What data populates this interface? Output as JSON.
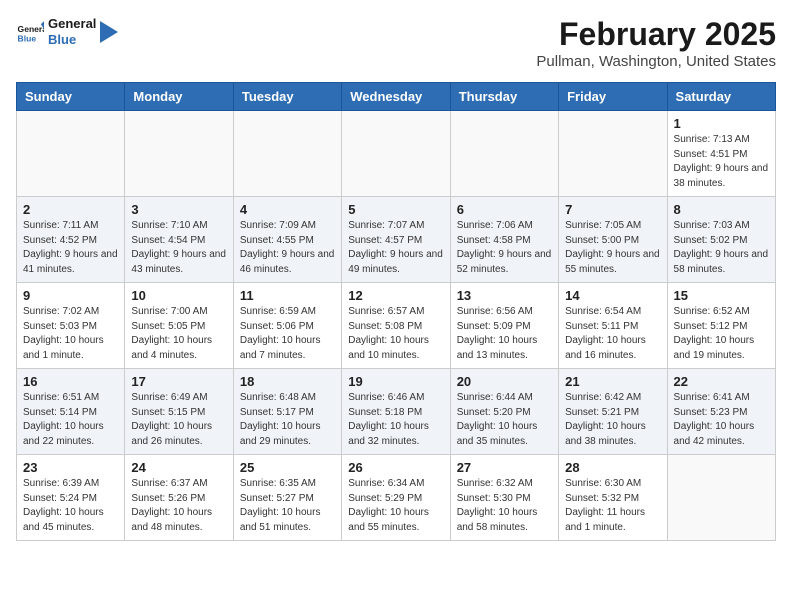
{
  "app": {
    "name_part1": "General",
    "name_part2": "Blue"
  },
  "header": {
    "month": "February 2025",
    "location": "Pullman, Washington, United States"
  },
  "weekdays": [
    "Sunday",
    "Monday",
    "Tuesday",
    "Wednesday",
    "Thursday",
    "Friday",
    "Saturday"
  ],
  "weeks": [
    [
      {
        "num": "",
        "info": ""
      },
      {
        "num": "",
        "info": ""
      },
      {
        "num": "",
        "info": ""
      },
      {
        "num": "",
        "info": ""
      },
      {
        "num": "",
        "info": ""
      },
      {
        "num": "",
        "info": ""
      },
      {
        "num": "1",
        "info": "Sunrise: 7:13 AM\nSunset: 4:51 PM\nDaylight: 9 hours and 38 minutes."
      }
    ],
    [
      {
        "num": "2",
        "info": "Sunrise: 7:11 AM\nSunset: 4:52 PM\nDaylight: 9 hours and 41 minutes."
      },
      {
        "num": "3",
        "info": "Sunrise: 7:10 AM\nSunset: 4:54 PM\nDaylight: 9 hours and 43 minutes."
      },
      {
        "num": "4",
        "info": "Sunrise: 7:09 AM\nSunset: 4:55 PM\nDaylight: 9 hours and 46 minutes."
      },
      {
        "num": "5",
        "info": "Sunrise: 7:07 AM\nSunset: 4:57 PM\nDaylight: 9 hours and 49 minutes."
      },
      {
        "num": "6",
        "info": "Sunrise: 7:06 AM\nSunset: 4:58 PM\nDaylight: 9 hours and 52 minutes."
      },
      {
        "num": "7",
        "info": "Sunrise: 7:05 AM\nSunset: 5:00 PM\nDaylight: 9 hours and 55 minutes."
      },
      {
        "num": "8",
        "info": "Sunrise: 7:03 AM\nSunset: 5:02 PM\nDaylight: 9 hours and 58 minutes."
      }
    ],
    [
      {
        "num": "9",
        "info": "Sunrise: 7:02 AM\nSunset: 5:03 PM\nDaylight: 10 hours and 1 minute."
      },
      {
        "num": "10",
        "info": "Sunrise: 7:00 AM\nSunset: 5:05 PM\nDaylight: 10 hours and 4 minutes."
      },
      {
        "num": "11",
        "info": "Sunrise: 6:59 AM\nSunset: 5:06 PM\nDaylight: 10 hours and 7 minutes."
      },
      {
        "num": "12",
        "info": "Sunrise: 6:57 AM\nSunset: 5:08 PM\nDaylight: 10 hours and 10 minutes."
      },
      {
        "num": "13",
        "info": "Sunrise: 6:56 AM\nSunset: 5:09 PM\nDaylight: 10 hours and 13 minutes."
      },
      {
        "num": "14",
        "info": "Sunrise: 6:54 AM\nSunset: 5:11 PM\nDaylight: 10 hours and 16 minutes."
      },
      {
        "num": "15",
        "info": "Sunrise: 6:52 AM\nSunset: 5:12 PM\nDaylight: 10 hours and 19 minutes."
      }
    ],
    [
      {
        "num": "16",
        "info": "Sunrise: 6:51 AM\nSunset: 5:14 PM\nDaylight: 10 hours and 22 minutes."
      },
      {
        "num": "17",
        "info": "Sunrise: 6:49 AM\nSunset: 5:15 PM\nDaylight: 10 hours and 26 minutes."
      },
      {
        "num": "18",
        "info": "Sunrise: 6:48 AM\nSunset: 5:17 PM\nDaylight: 10 hours and 29 minutes."
      },
      {
        "num": "19",
        "info": "Sunrise: 6:46 AM\nSunset: 5:18 PM\nDaylight: 10 hours and 32 minutes."
      },
      {
        "num": "20",
        "info": "Sunrise: 6:44 AM\nSunset: 5:20 PM\nDaylight: 10 hours and 35 minutes."
      },
      {
        "num": "21",
        "info": "Sunrise: 6:42 AM\nSunset: 5:21 PM\nDaylight: 10 hours and 38 minutes."
      },
      {
        "num": "22",
        "info": "Sunrise: 6:41 AM\nSunset: 5:23 PM\nDaylight: 10 hours and 42 minutes."
      }
    ],
    [
      {
        "num": "23",
        "info": "Sunrise: 6:39 AM\nSunset: 5:24 PM\nDaylight: 10 hours and 45 minutes."
      },
      {
        "num": "24",
        "info": "Sunrise: 6:37 AM\nSunset: 5:26 PM\nDaylight: 10 hours and 48 minutes."
      },
      {
        "num": "25",
        "info": "Sunrise: 6:35 AM\nSunset: 5:27 PM\nDaylight: 10 hours and 51 minutes."
      },
      {
        "num": "26",
        "info": "Sunrise: 6:34 AM\nSunset: 5:29 PM\nDaylight: 10 hours and 55 minutes."
      },
      {
        "num": "27",
        "info": "Sunrise: 6:32 AM\nSunset: 5:30 PM\nDaylight: 10 hours and 58 minutes."
      },
      {
        "num": "28",
        "info": "Sunrise: 6:30 AM\nSunset: 5:32 PM\nDaylight: 11 hours and 1 minute."
      },
      {
        "num": "",
        "info": ""
      }
    ]
  ]
}
